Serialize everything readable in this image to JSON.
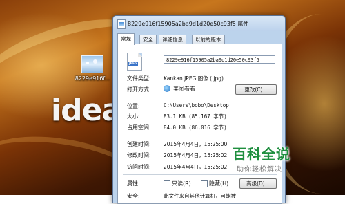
{
  "desktop": {
    "icon_label": "8229e916f...",
    "brand_text": "idea"
  },
  "window": {
    "title": "8229e916f15905a2ba9d1d20e50c93f5 属性",
    "tabs": [
      "常规",
      "安全",
      "详细信息",
      "以前的版本"
    ],
    "active_tab": "常规",
    "file_icon_tag": "JPEG",
    "file_name": "8229e916f15905a2ba9d1d20e50c93f5",
    "rows": {
      "type_label": "文件类型:",
      "type_value": "Kankan JPEG 图像 (.jpg)",
      "open_label": "打开方式:",
      "open_value": "美图看看",
      "change_button": "更改(C)...",
      "location_label": "位置:",
      "location_value": "C:\\Users\\bobo\\Desktop",
      "size_label": "大小:",
      "size_value": "83.1 KB (85,167 字节)",
      "disk_label": "占用空间:",
      "disk_value": "84.0 KB (86,016 字节)",
      "created_label": "创建时间:",
      "created_value": "2015年4月4日，15:25:00",
      "modified_label": "修改时间:",
      "modified_value": "2015年4月4日，15:25:02",
      "accessed_label": "访问时间:",
      "accessed_value": "2015年4月4日，15:25:02",
      "attr_label": "属性:",
      "readonly_label": "只读(R)",
      "hidden_label": "隐藏(H)",
      "advanced_button": "高级(D)...",
      "security_label": "安全:",
      "security_value": "此文件来自其他计算机，可能被"
    }
  },
  "watermark": {
    "title": "百科全说",
    "subtitle": "助你轻松解决"
  },
  "colors": {
    "watermark_green": "#1e8e3e",
    "window_frame": "#bcd3ec"
  }
}
